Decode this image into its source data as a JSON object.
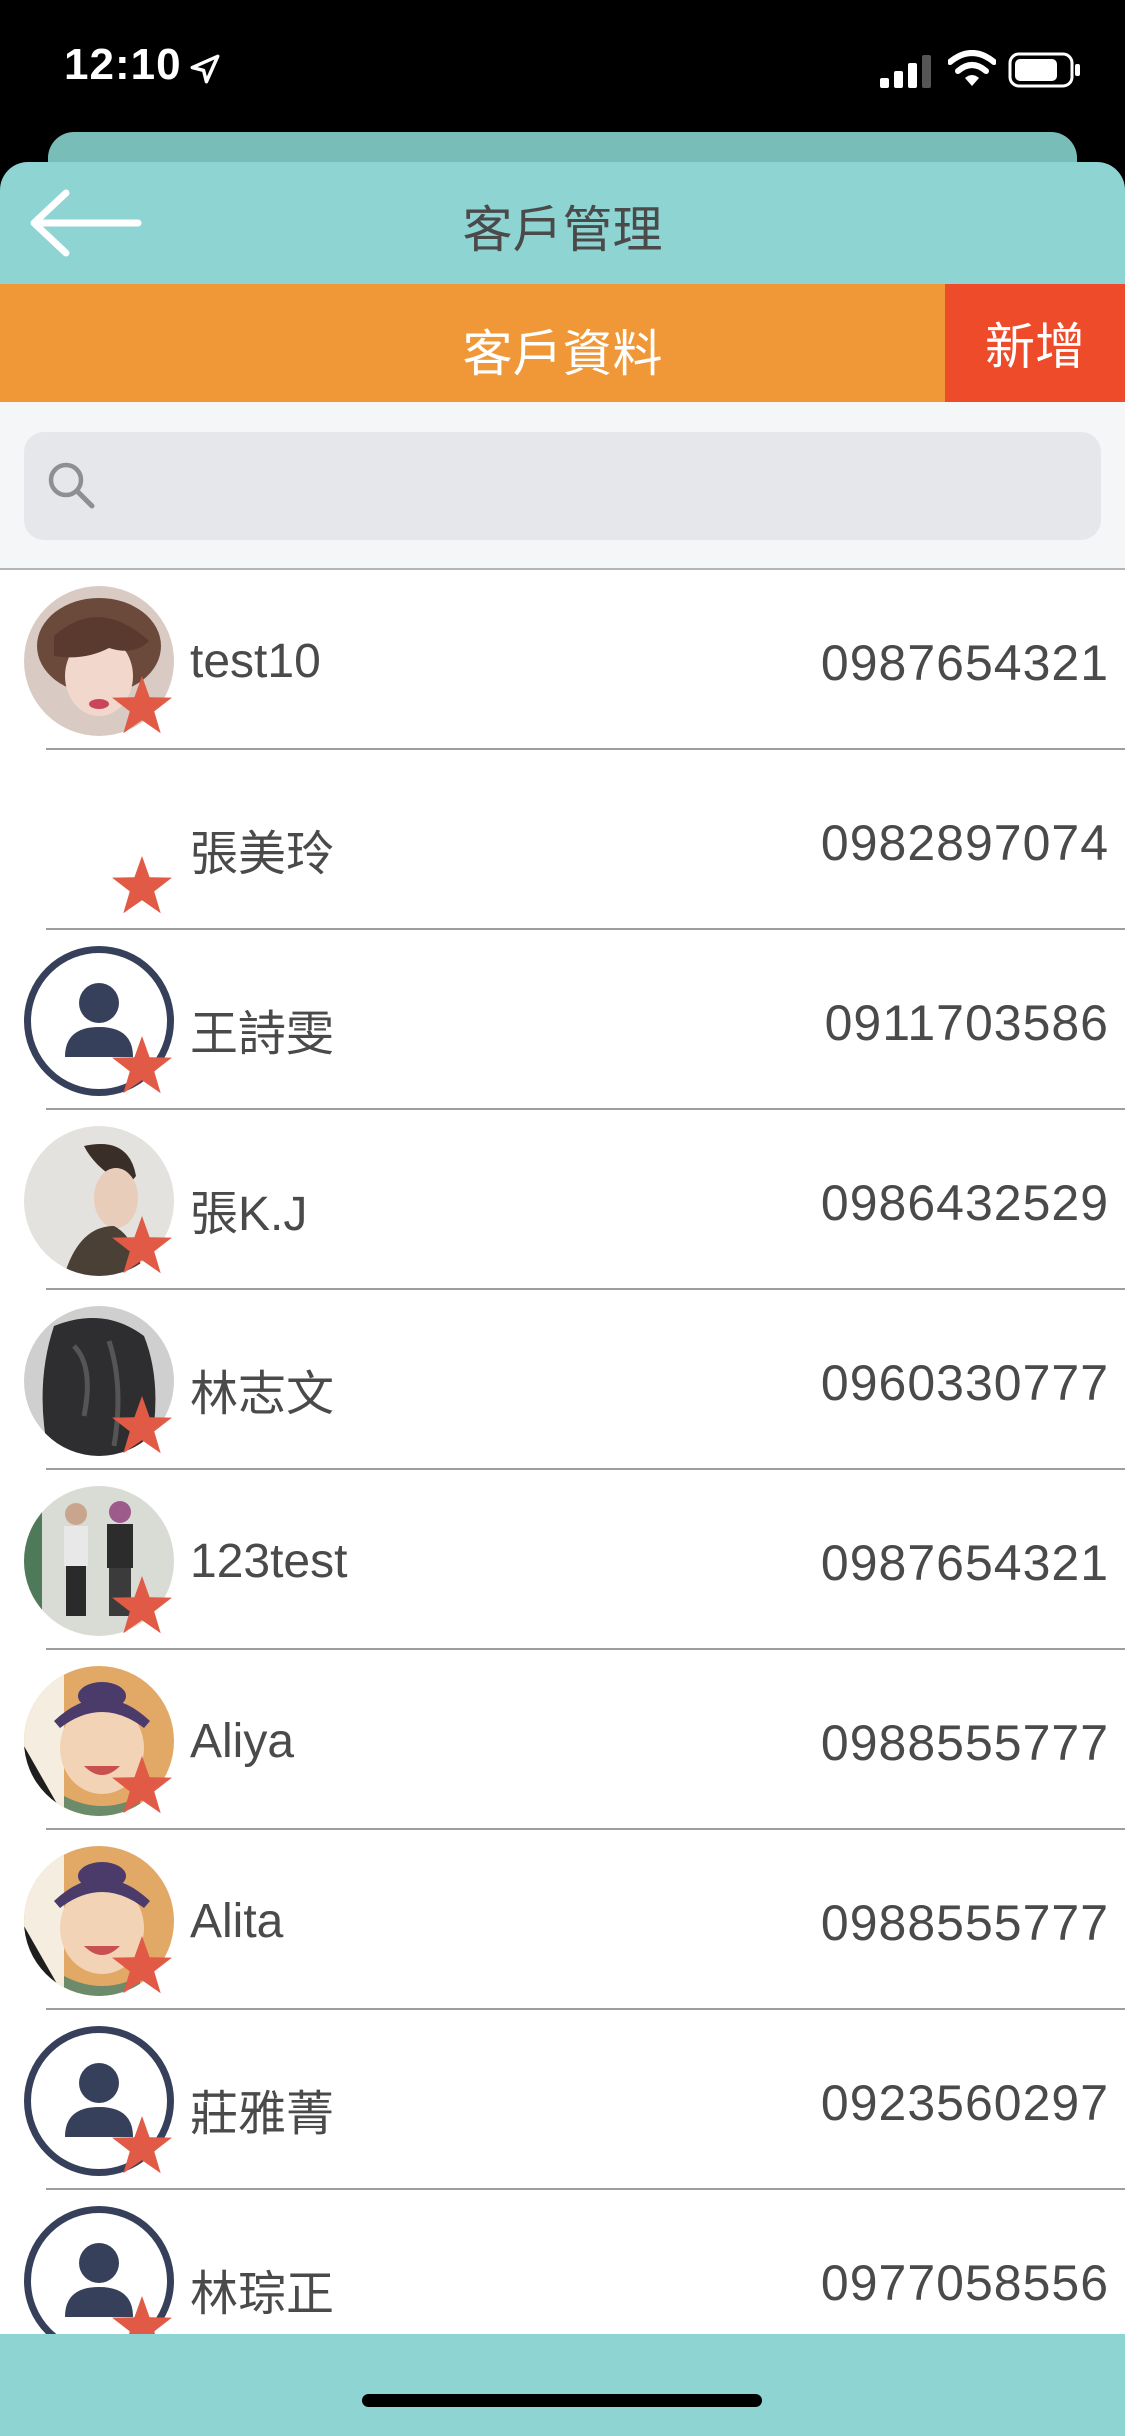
{
  "status_bar": {
    "time": "12:10"
  },
  "header": {
    "title": "客戶管理"
  },
  "section": {
    "title": "客戶資料",
    "add_label": "新增"
  },
  "search": {
    "placeholder": "",
    "value": ""
  },
  "colors": {
    "header_bg": "#8ED4D2",
    "section_bg": "#F09837",
    "add_bg": "#EE4B2A",
    "star": "#E05A45"
  },
  "customers": [
    {
      "name": "test10",
      "phone": "0987654321",
      "avatar": "photo-woman-short-hair"
    },
    {
      "name": "張美玲",
      "phone": "0982897074",
      "avatar": "none"
    },
    {
      "name": "王詩雯",
      "phone": "0911703586",
      "avatar": "default-person-icon"
    },
    {
      "name": "張K.J",
      "phone": "0986432529",
      "avatar": "photo-man-profile"
    },
    {
      "name": "林志文",
      "phone": "0960330777",
      "avatar": "photo-long-dark-hair"
    },
    {
      "name": "123test",
      "phone": "0987654321",
      "avatar": "photo-two-people"
    },
    {
      "name": "Aliya",
      "phone": "0988555777",
      "avatar": "photo-child-headband"
    },
    {
      "name": "Alita",
      "phone": "0988555777",
      "avatar": "photo-child-headband"
    },
    {
      "name": "莊雅菁",
      "phone": "0923560297",
      "avatar": "default-person-icon"
    },
    {
      "name": "林琮正",
      "phone": "0977058556",
      "avatar": "default-person-icon"
    }
  ]
}
